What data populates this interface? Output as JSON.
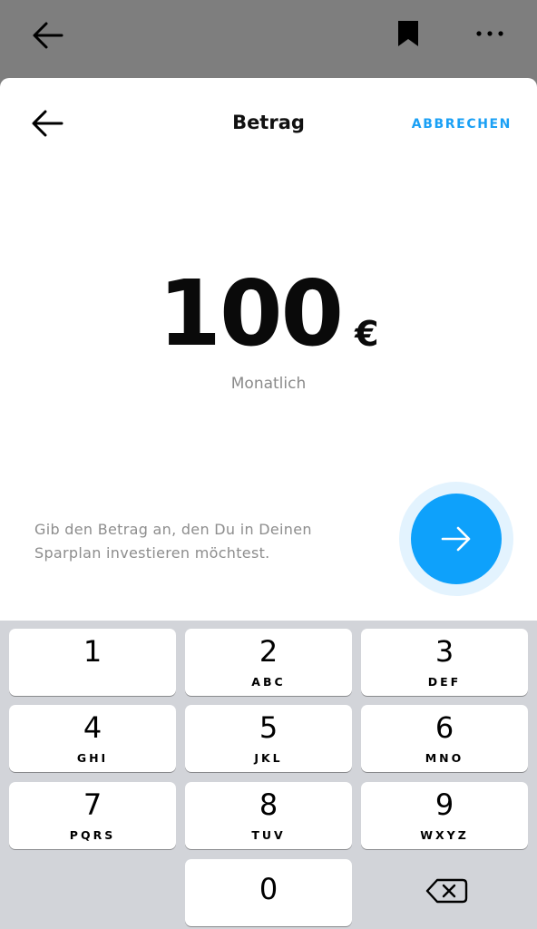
{
  "top_bar": {
    "back_icon": "arrow-left-icon",
    "bookmark_icon": "bookmark-icon",
    "more_icon": "more-horizontal-icon"
  },
  "sheet": {
    "title": "Betrag",
    "cancel_label": "ABBRECHEN",
    "back_icon": "arrow-left-icon"
  },
  "amount": {
    "value": "100",
    "currency": "€",
    "frequency": "Monatlich"
  },
  "hint": "Gib den Betrag an, den Du in Deinen Sparplan investieren möchtest.",
  "next_button": {
    "icon": "arrow-right-icon",
    "color": "#0ea1fb"
  },
  "accent_color": "#1aa0f5",
  "keypad": {
    "keys": [
      {
        "digit": "1",
        "letters": ""
      },
      {
        "digit": "2",
        "letters": "ABC"
      },
      {
        "digit": "3",
        "letters": "DEF"
      },
      {
        "digit": "4",
        "letters": "GHI"
      },
      {
        "digit": "5",
        "letters": "JKL"
      },
      {
        "digit": "6",
        "letters": "MNO"
      },
      {
        "digit": "7",
        "letters": "PQRS"
      },
      {
        "digit": "8",
        "letters": "TUV"
      },
      {
        "digit": "9",
        "letters": "WXYZ"
      },
      {
        "digit": "0",
        "letters": ""
      }
    ],
    "delete_icon": "backspace-icon"
  }
}
